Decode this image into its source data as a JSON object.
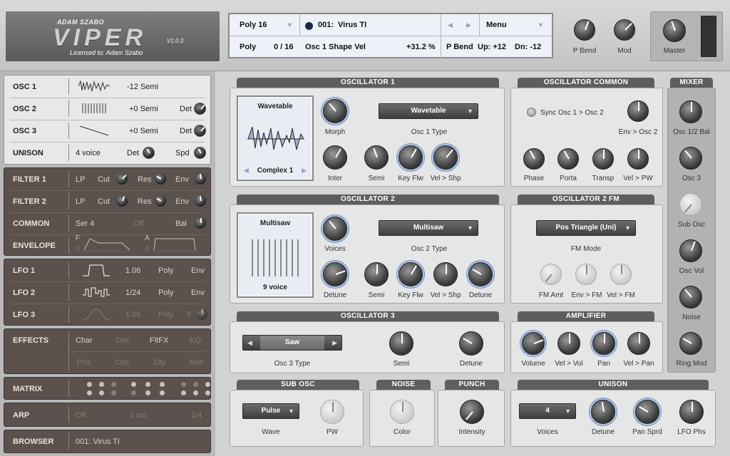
{
  "brand": {
    "author": "ADAM SZABO",
    "name": "VIPER",
    "version": "V1.0.3",
    "license": "Licensed to: Adam Szabo"
  },
  "display": {
    "poly_mode": "Poly 16",
    "patch_number": "001:",
    "patch_name": "Virus TI",
    "menu": "Menu",
    "mode": "Poly",
    "voices": "0 / 16",
    "param_name": "Osc 1 Shape Vel",
    "param_value": "+31.2 %",
    "pbend": "P Bend",
    "up": "Up: +12",
    "dn": "Dn: -12"
  },
  "top_knobs": {
    "pbend": "P Bend",
    "mod": "Mod",
    "master": "Master"
  },
  "left": {
    "osc1": {
      "name": "OSC 1",
      "value": "-12 Semi"
    },
    "osc2": {
      "name": "OSC 2",
      "value": "+0 Semi",
      "det": "Det"
    },
    "osc3": {
      "name": "OSC 3",
      "value": "+0 Semi",
      "det": "Det"
    },
    "unison": {
      "name": "UNISON",
      "value": "4 voice",
      "det": "Det",
      "spd": "Spd"
    },
    "filter1": {
      "name": "FILTER 1",
      "type": "LP",
      "cut": "Cut",
      "res": "Res",
      "env": "Env"
    },
    "filter2": {
      "name": "FILTER 2",
      "type": "LP",
      "cut": "Cut",
      "res": "Res",
      "env": "Env"
    },
    "common": {
      "name": "COMMON",
      "routing": "Ser 4",
      "off": "Off",
      "bal": "Bal"
    },
    "envelope": {
      "name": "ENVELOPE",
      "f": "F",
      "a": "A",
      "n3": "3",
      "n4": "4"
    },
    "lfo1": {
      "name": "LFO 1",
      "rate": "1.06",
      "mode": "Poly",
      "env": "Env"
    },
    "lfo2": {
      "name": "LFO 2",
      "rate": "1/24",
      "mode": "Poly",
      "env": "Env"
    },
    "lfo3": {
      "name": "LFO 3",
      "rate": "1.06",
      "mode": "Poly",
      "f": "F"
    },
    "effects": {
      "name": "EFFECTS",
      "char": "Char",
      "dist": "Dist",
      "fltfx": "FltFX",
      "eq": "EQ",
      "phs": "Phs",
      "chs": "Chs",
      "dly": "Dly",
      "rvb": "Rvb"
    },
    "matrix": {
      "name": "MATRIX"
    },
    "arp": {
      "name": "ARP",
      "off": "Off",
      "oct": "1 oct",
      "div": "1/4"
    },
    "browser": {
      "name": "BROWSER",
      "patch": "001: Virus TI"
    }
  },
  "osc1": {
    "title": "OSCILLATOR 1",
    "wave_title": "Wavetable",
    "wave_name": "Complex 1",
    "type_value": "Wavetable",
    "type_label": "Osc 1 Type",
    "morph": "Morph",
    "inter": "Inter",
    "semi": "Semi",
    "keyflw": "Key Flw",
    "velshp": "Vel > Shp"
  },
  "osc_common": {
    "title": "OSCILLATOR COMMON",
    "sync": "Sync Osc 1 > Osc 2",
    "env_osc2": "Env > Osc 2",
    "phase": "Phase",
    "porta": "Porta",
    "transp": "Transp",
    "velpw": "Vel > PW"
  },
  "mixer": {
    "title": "MIXER",
    "bal": "Osc 1/2 Bal",
    "osc3": "Osc 3",
    "sub": "Sub Osc",
    "oscvol": "Osc Vol",
    "noise": "Noise",
    "ring": "Ring Mod"
  },
  "osc2": {
    "title": "OSCILLATOR 2",
    "wave_title": "Multisaw",
    "wave_name": "9 voice",
    "type_value": "Multisaw",
    "type_label": "Osc 2 Type",
    "voices": "Voices",
    "detune": "Detune",
    "semi": "Semi",
    "keyflw": "Key Flw",
    "velshp": "Vel > Shp",
    "detune2": "Detune"
  },
  "osc2fm": {
    "title": "OSCILLATOR 2 FM",
    "mode_value": "Pos Triangle (Uni)",
    "mode_label": "FM Mode",
    "fmamt": "FM Amt",
    "envfm": "Env > FM",
    "velfm": "Vel > FM"
  },
  "osc3": {
    "title": "OSCILLATOR 3",
    "type_value": "Saw",
    "type_label": "Osc 3 Type",
    "semi": "Semi",
    "detune": "Detune"
  },
  "amp": {
    "title": "AMPLIFIER",
    "volume": "Volume",
    "velvol": "Vel > Vol",
    "pan": "Pan",
    "velpan": "Vel > Pan"
  },
  "subosc": {
    "title": "SUB OSC",
    "wave_value": "Pulse",
    "wave": "Wave",
    "pw": "PW"
  },
  "noise": {
    "title": "NOISE",
    "color": "Color"
  },
  "punch": {
    "title": "PUNCH",
    "intensity": "Intensity"
  },
  "unison": {
    "title": "UNISON",
    "voices_value": "4",
    "voices": "Voices",
    "detune": "Detune",
    "pansprd": "Pan Sprd",
    "lfophs": "LFO Phs"
  },
  "colors": {
    "dark_panel": "#5b524d",
    "accent_ring": "#6c8fc8",
    "section_title": "#5e5e5e"
  }
}
